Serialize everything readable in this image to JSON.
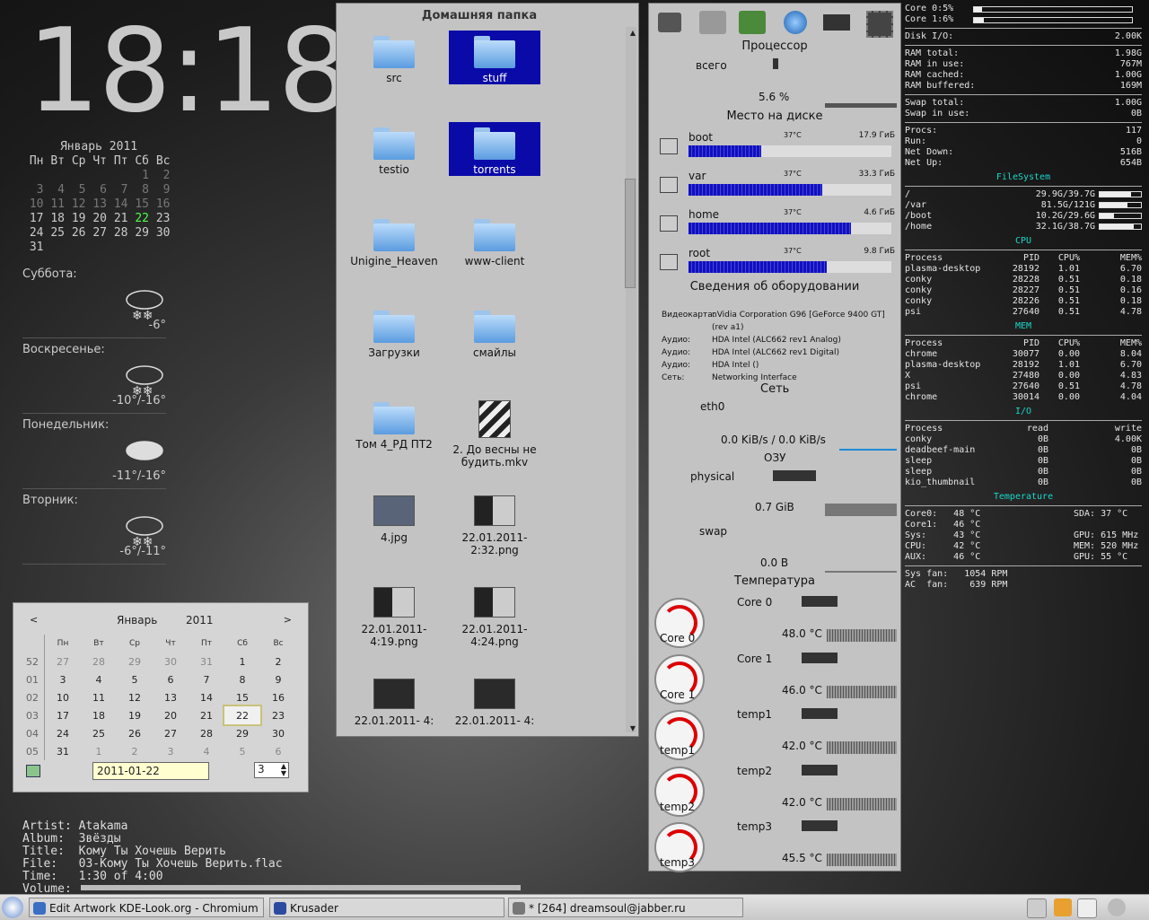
{
  "clock": "18:18",
  "month_calendar": {
    "title": "Январь 2011",
    "weekdays": [
      "Пн",
      "Вт",
      "Ср",
      "Чт",
      "Пт",
      "Сб",
      "Вс"
    ],
    "weeks": [
      [
        "",
        "",
        "",
        "",
        "",
        "1",
        "2"
      ],
      [
        "3",
        "4",
        "5",
        "6",
        "7",
        "8",
        "9"
      ],
      [
        "10",
        "11",
        "12",
        "13",
        "14",
        "15",
        "16"
      ],
      [
        "17",
        "18",
        "19",
        "20",
        "21",
        "22",
        "23"
      ],
      [
        "24",
        "25",
        "26",
        "27",
        "28",
        "29",
        "30"
      ],
      [
        "31",
        "",
        "",
        "",
        "",
        "",
        ""
      ]
    ],
    "today": "22"
  },
  "weather": [
    {
      "day": "Суббота:",
      "temp": "-6°"
    },
    {
      "day": "Воскресенье:",
      "temp": "-10°/-16°"
    },
    {
      "day": "Понедельник:",
      "temp": "-11°/-16°"
    },
    {
      "day": "Вторник:",
      "temp": "-6°/-11°"
    }
  ],
  "gtk_calendar": {
    "prev": "<",
    "next": ">",
    "month": "Январь",
    "year": "2011",
    "headers": [
      "Пн",
      "Вт",
      "Ср",
      "Чт",
      "Пт",
      "Сб",
      "Вс"
    ],
    "rows": [
      {
        "wk": "52",
        "days": [
          "27",
          "28",
          "29",
          "30",
          "31",
          "1",
          "2"
        ]
      },
      {
        "wk": "01",
        "days": [
          "3",
          "4",
          "5",
          "6",
          "7",
          "8",
          "9"
        ]
      },
      {
        "wk": "02",
        "days": [
          "10",
          "11",
          "12",
          "13",
          "14",
          "15",
          "16"
        ]
      },
      {
        "wk": "03",
        "days": [
          "17",
          "18",
          "19",
          "20",
          "21",
          "22",
          "23"
        ]
      },
      {
        "wk": "04",
        "days": [
          "24",
          "25",
          "26",
          "27",
          "28",
          "29",
          "30"
        ]
      },
      {
        "wk": "05",
        "days": [
          "31",
          "1",
          "2",
          "3",
          "4",
          "5",
          "6"
        ]
      }
    ],
    "selected": "22",
    "date_value": "2011-01-22",
    "spin_value": "3"
  },
  "player": [
    "Artist: Atakama",
    "Album:  Звёзды",
    "Title:  Кому Ты Хочешь Верить",
    "File:   03-Кому Ты Хочешь Верить.flac",
    "Time:   1:30 of 4:00",
    "Volume:"
  ],
  "files": {
    "title": "Домашняя папка",
    "items": [
      {
        "name": "src",
        "kind": "folder",
        "selected": false
      },
      {
        "name": "stuff",
        "kind": "folder",
        "selected": true
      },
      {
        "name": "testio",
        "kind": "folder",
        "selected": false
      },
      {
        "name": "torrents",
        "kind": "folder",
        "selected": true
      },
      {
        "name": "Unigine_Heaven",
        "kind": "folder",
        "selected": false
      },
      {
        "name": "www-client",
        "kind": "folder",
        "selected": false
      },
      {
        "name": "Загрузки",
        "kind": "folder",
        "selected": false
      },
      {
        "name": "смайлы",
        "kind": "folder",
        "selected": false
      },
      {
        "name": "Том 4_РД ПТ2",
        "kind": "folder",
        "selected": false
      },
      {
        "name": "2. До весны не будить.mkv",
        "kind": "video",
        "selected": false
      },
      {
        "name": "4.jpg",
        "kind": "image",
        "selected": false
      },
      {
        "name": "22.01.2011- 2:32.png",
        "kind": "image",
        "selected": false
      },
      {
        "name": "22.01.2011- 4:19.png",
        "kind": "image",
        "selected": false
      },
      {
        "name": "22.01.2011- 4:24.png",
        "kind": "image",
        "selected": false
      },
      {
        "name": "22.01.2011- 4:",
        "kind": "image",
        "selected": false
      },
      {
        "name": "22.01.2011- 4:",
        "kind": "image",
        "selected": false
      }
    ]
  },
  "hw": {
    "cpu_title": "Процессор",
    "cpu_total_label": "всего",
    "cpu_percent": "5.6 %",
    "disk_title": "Место на диске",
    "disks": [
      {
        "name": "boot",
        "temp": "37°C",
        "size": "17.9 ГиБ",
        "fill": 0.36
      },
      {
        "name": "var",
        "temp": "37°C",
        "size": "33.3 ГиБ",
        "fill": 0.66
      },
      {
        "name": "home",
        "temp": "37°C",
        "size": "4.6 ГиБ",
        "fill": 0.8
      },
      {
        "name": "root",
        "temp": "37°C",
        "size": "9.8 ГиБ",
        "fill": 0.68
      }
    ],
    "hw_title": "Сведения об оборудовании",
    "hw_info": [
      {
        "k": "Видеокарта:",
        "v": "nVidia Corporation G96 [GeForce 9400 GT] (rev a1)"
      },
      {
        "k": "Аудио:",
        "v": "HDA Intel (ALC662 rev1 Analog)"
      },
      {
        "k": "Аудио:",
        "v": "HDA Intel (ALC662 rev1 Digital)"
      },
      {
        "k": "Аудио:",
        "v": "HDA Intel ()"
      },
      {
        "k": "Сеть:",
        "v": "Networking Interface"
      }
    ],
    "net_title": "Сеть",
    "net_iface": "eth0",
    "net_rate": "0.0 KiB/s / 0.0 KiB/s",
    "ram_title": "ОЗУ",
    "ram_physical": "physical",
    "ram_physical_value": "0.7 GiB",
    "ram_swap": "swap",
    "ram_swap_value": "0.0 B",
    "temp_title": "Температура",
    "temps": [
      {
        "name": "Core 0",
        "value": "48.0 °C"
      },
      {
        "name": "Core 1",
        "value": "46.0 °C"
      },
      {
        "name": "temp1",
        "value": "42.0 °C"
      },
      {
        "name": "temp2",
        "value": "42.0 °C"
      },
      {
        "name": "temp3",
        "value": "45.5 °C"
      }
    ]
  },
  "conky": {
    "cores": [
      {
        "k": "Core 0:",
        "v": "5%",
        "fill": 0.05
      },
      {
        "k": "Core 1:",
        "v": "6%",
        "fill": 0.06
      }
    ],
    "disk_io": {
      "k": "Disk I/O:",
      "v": "2.00K"
    },
    "ram": [
      {
        "k": "RAM total:",
        "v": "1.98G"
      },
      {
        "k": "RAM in use:",
        "v": "767M"
      },
      {
        "k": "RAM cached:",
        "v": "1.00G"
      },
      {
        "k": "RAM buffered:",
        "v": "169M"
      }
    ],
    "swap": [
      {
        "k": "Swap total:",
        "v": "1.00G"
      },
      {
        "k": "Swap in use:",
        "v": "0B"
      }
    ],
    "procs": [
      {
        "k": "Procs:",
        "v": "117"
      },
      {
        "k": "Run:",
        "v": "0"
      },
      {
        "k": "Net Down:",
        "v": "516B"
      },
      {
        "k": "Net Up:",
        "v": "654B"
      }
    ],
    "fs_title": "FileSystem",
    "fs": [
      {
        "k": "/",
        "v": "29.9G/39.7G",
        "fill": 0.75
      },
      {
        "k": "/var",
        "v": "81.5G/121G",
        "fill": 0.67
      },
      {
        "k": "/boot",
        "v": "10.2G/29.6G",
        "fill": 0.34
      },
      {
        "k": "/home",
        "v": "32.1G/38.7G",
        "fill": 0.83
      }
    ],
    "cpu_title": "CPU",
    "proc_header": [
      "Process",
      "PID",
      "CPU%",
      "MEM%"
    ],
    "cpu_procs": [
      [
        "plasma-desktop",
        "28192",
        "1.01",
        "6.70"
      ],
      [
        "conky",
        "28228",
        "0.51",
        "0.18"
      ],
      [
        "conky",
        "28227",
        "0.51",
        "0.16"
      ],
      [
        "conky",
        "28226",
        "0.51",
        "0.18"
      ],
      [
        "psi",
        "27640",
        "0.51",
        "4.78"
      ]
    ],
    "mem_title": "MEM",
    "mem_procs": [
      [
        "chrome",
        "30077",
        "0.00",
        "8.04"
      ],
      [
        "plasma-desktop",
        "28192",
        "1.01",
        "6.70"
      ],
      [
        "X",
        "27480",
        "0.00",
        "4.83"
      ],
      [
        "psi",
        "27640",
        "0.51",
        "4.78"
      ],
      [
        "chrome",
        "30014",
        "0.00",
        "4.04"
      ]
    ],
    "io_title": "I/O",
    "io_header": [
      "Process",
      "read",
      "write"
    ],
    "io_procs": [
      [
        "conky",
        "0B",
        "4.00K"
      ],
      [
        "deadbeef-main",
        "0B",
        "0B"
      ],
      [
        "sleep",
        "0B",
        "0B"
      ],
      [
        "sleep",
        "0B",
        "0B"
      ],
      [
        "kio_thumbnail",
        "0B",
        "0B"
      ]
    ],
    "temp_title": "Temperature",
    "temps_left": [
      "Core0:   48 °C",
      "Core1:   46 °C",
      "Sys:     43 °C",
      "CPU:     42 °C",
      "AUX:     46 °C"
    ],
    "temps_right": [
      "SDA: 37 °C",
      "",
      "GPU: 615 MHz",
      "MEM: 520 MHz",
      "GPU: 55 °C"
    ],
    "fans": [
      "Sys fan:   1054 RPM",
      "AC  fan:    639 RPM"
    ]
  },
  "taskbar": {
    "tasks": [
      {
        "label": "Edit Artwork KDE-Look.org - Chromium",
        "color": "#3a6fc4"
      },
      {
        "label": "Krusader",
        "color": "#2c4aa0"
      },
      {
        "label": "* [264] dreamsoul@jabber.ru",
        "color": "#777777"
      }
    ]
  }
}
